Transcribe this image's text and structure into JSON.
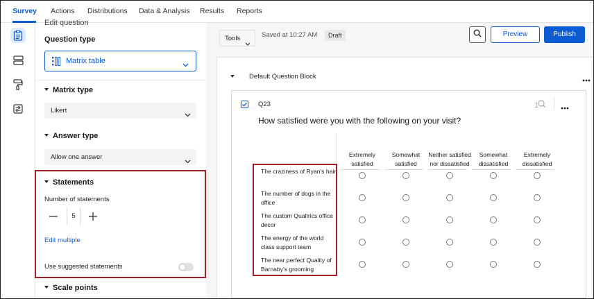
{
  "nav": {
    "tabs": [
      "Survey",
      "Actions",
      "Distributions",
      "Data & Analysis",
      "Results",
      "Reports"
    ],
    "active_tab": "Survey"
  },
  "rail": {
    "icons": [
      "survey-clipboard-icon",
      "blocks-icon",
      "paint-roller-icon",
      "settings-sliders-icon"
    ]
  },
  "panel": {
    "partial_title": "Edit question",
    "question_type_label": "Question type",
    "question_type_value": "Matrix table",
    "matrix_type_label": "Matrix type",
    "matrix_type_value": "Likert",
    "answer_type_label": "Answer type",
    "answer_type_value": "Allow one answer",
    "statements_label": "Statements",
    "number_of_statements_label": "Number of statements",
    "number_of_statements": "5",
    "edit_multiple": "Edit multiple",
    "use_suggested": "Use suggested statements",
    "use_suggested_on": false,
    "scale_points_label": "Scale points"
  },
  "toolbar": {
    "tools": "Tools",
    "saved": "Saved at 10:27 AM",
    "draft": "Draft",
    "preview": "Preview",
    "publish": "Publish"
  },
  "block": {
    "title": "Default Question Block"
  },
  "question": {
    "id": "Q23",
    "text": "How satisfied were you with the following on your visit?",
    "columns": [
      "Extremely satisfied",
      "Somewhat satisfied",
      "Neither satisfied nor dissatisfied",
      "Somewhat dissatisfied",
      "Extremely dissatisfied"
    ],
    "statements": [
      "The craziness of Ryan's hair",
      "The number of dogs in the office",
      "The custom Qualtrics office decor",
      "The energy of the world class support team",
      "The near perfect Quality of Barnaby's grooming"
    ]
  },
  "colors": {
    "accent": "#0b5bd3",
    "highlight_box": "#a3202a"
  }
}
